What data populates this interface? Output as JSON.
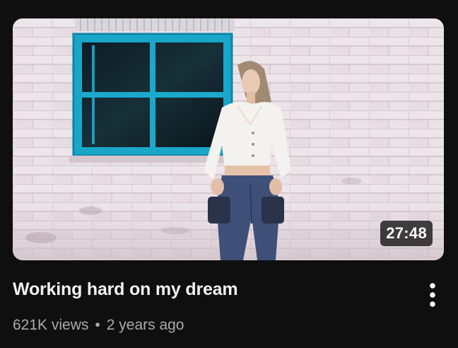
{
  "video": {
    "title": "Working hard on my dream",
    "duration": "27:48",
    "views": "621K views",
    "separator": "•",
    "age": "2 years ago"
  },
  "icons": {
    "menu": "more-vert-icon"
  },
  "colors": {
    "background": "#0f0f0f",
    "title_text": "#f1f1f1",
    "meta_text": "#aaaaaa",
    "duration_badge": "#000000b8"
  }
}
